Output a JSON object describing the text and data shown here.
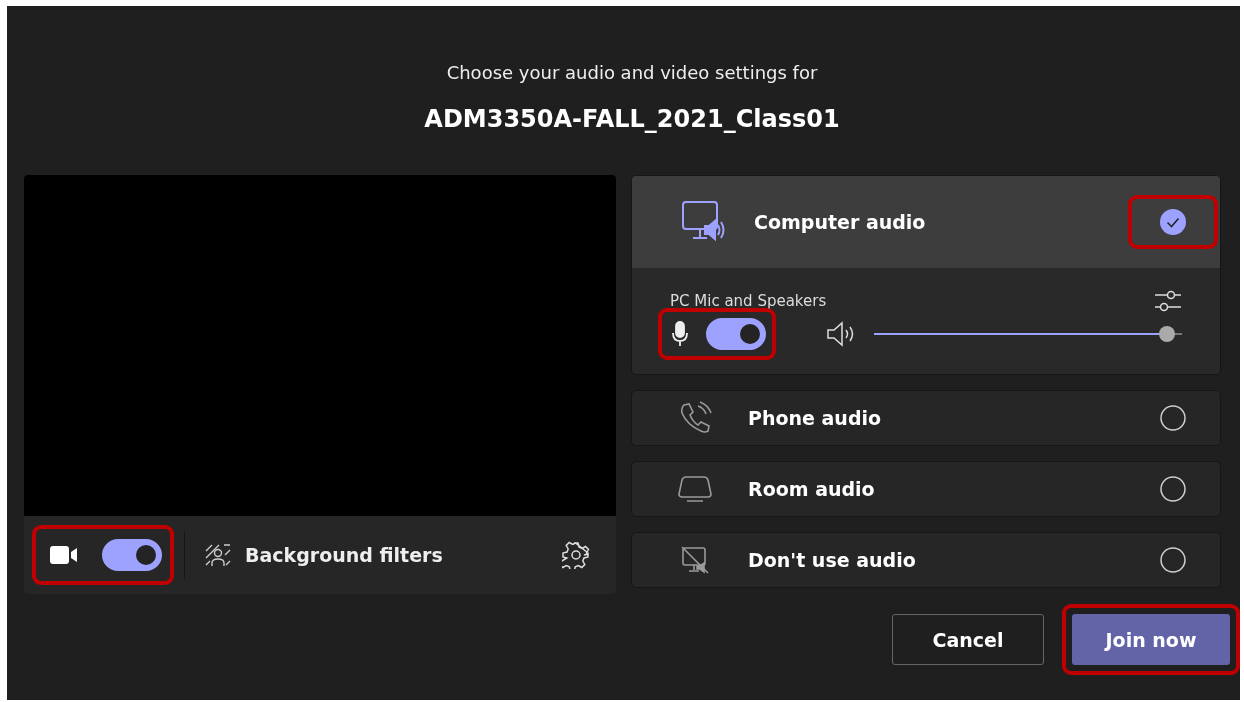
{
  "heading": "Choose your audio and video settings for",
  "meeting_title": "ADM3350A-FALL_2021_Class01",
  "video": {
    "camera_on": true,
    "highlighted": true,
    "background_filters": "Background filters"
  },
  "audio_options": [
    {
      "kind": "computer",
      "label": "Computer audio",
      "selected": true,
      "highlighted": true,
      "device": "PC Mic and Speakers",
      "mic_on": true,
      "mic_highlighted": true,
      "volume": {
        "level": 0.95
      }
    },
    {
      "kind": "phone",
      "label": "Phone audio",
      "selected": false,
      "highlighted": false
    },
    {
      "kind": "room",
      "label": "Room audio",
      "selected": false,
      "highlighted": false
    },
    {
      "kind": "none",
      "label": "Don't use audio",
      "selected": false,
      "highlighted": false
    }
  ],
  "buttons": [
    {
      "label": "Cancel",
      "kind": "secondary",
      "highlighted": false
    },
    {
      "label": "Join now",
      "kind": "primary",
      "highlighted": true
    }
  ]
}
